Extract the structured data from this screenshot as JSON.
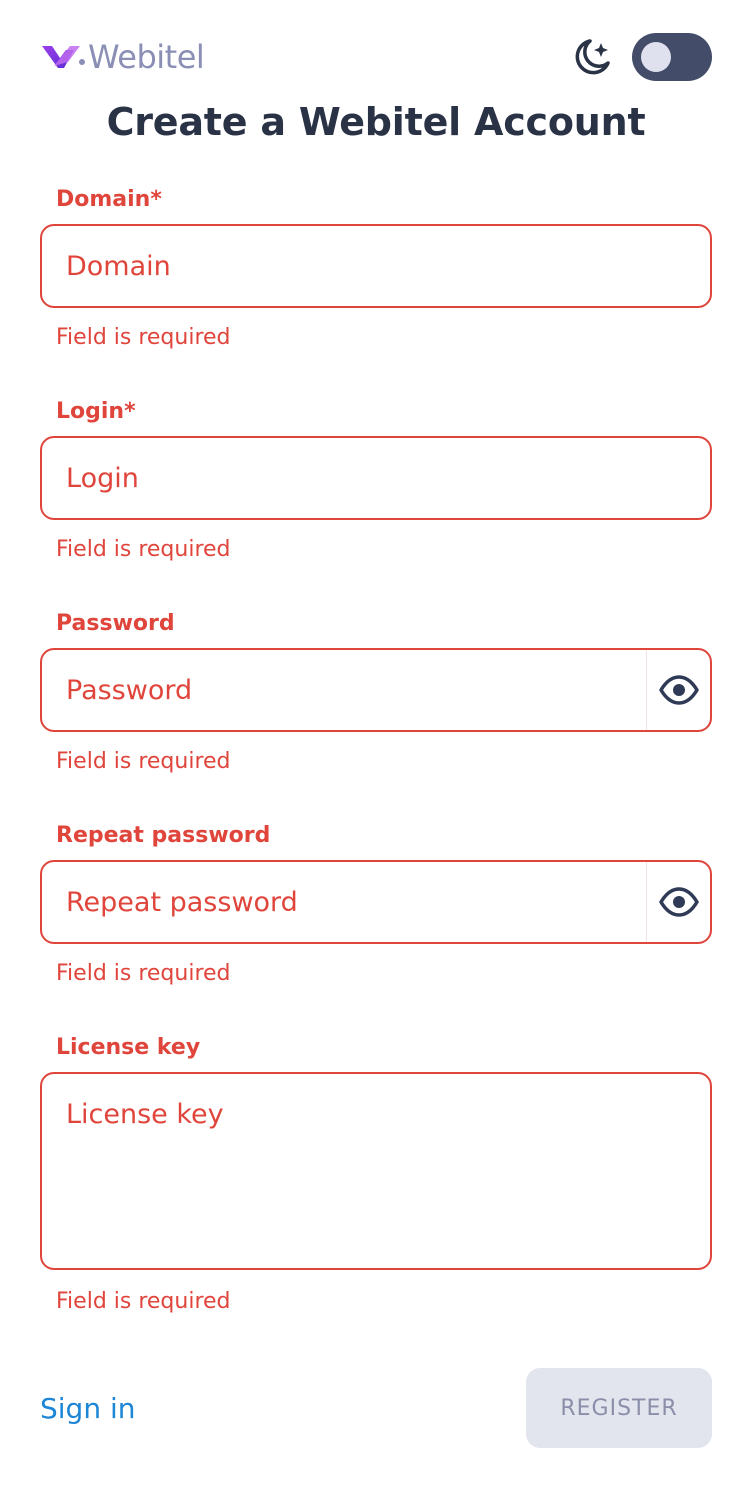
{
  "header": {
    "logo_text": "Webitel",
    "theme_icon": "moon-stars-icon",
    "theme_toggle_on": false
  },
  "title": "Create a Webitel Account",
  "fields": {
    "domain": {
      "label": "Domain*",
      "placeholder": "Domain",
      "value": "",
      "error": "Field is required"
    },
    "login": {
      "label": "Login*",
      "placeholder": "Login",
      "value": "",
      "error": "Field is required"
    },
    "password": {
      "label": "Password",
      "placeholder": "Password",
      "value": "",
      "error": "Field is required",
      "icon": "eye-icon"
    },
    "repeat_password": {
      "label": "Repeat password",
      "placeholder": "Repeat password",
      "value": "",
      "error": "Field is required",
      "icon": "eye-icon"
    },
    "license_key": {
      "label": "License key",
      "placeholder": "License key",
      "value": "",
      "error": "Field is required"
    }
  },
  "footer": {
    "signin_label": "Sign in",
    "register_label": "REGISTER"
  },
  "colors": {
    "error": "#e0453c",
    "title": "#2a3246",
    "link": "#1e86d6",
    "toggle_bg": "#434c68",
    "button_disabled_bg": "#e2e4ee",
    "logo_text": "#8b8fb5",
    "logo_mark": "#7b3fe4"
  }
}
